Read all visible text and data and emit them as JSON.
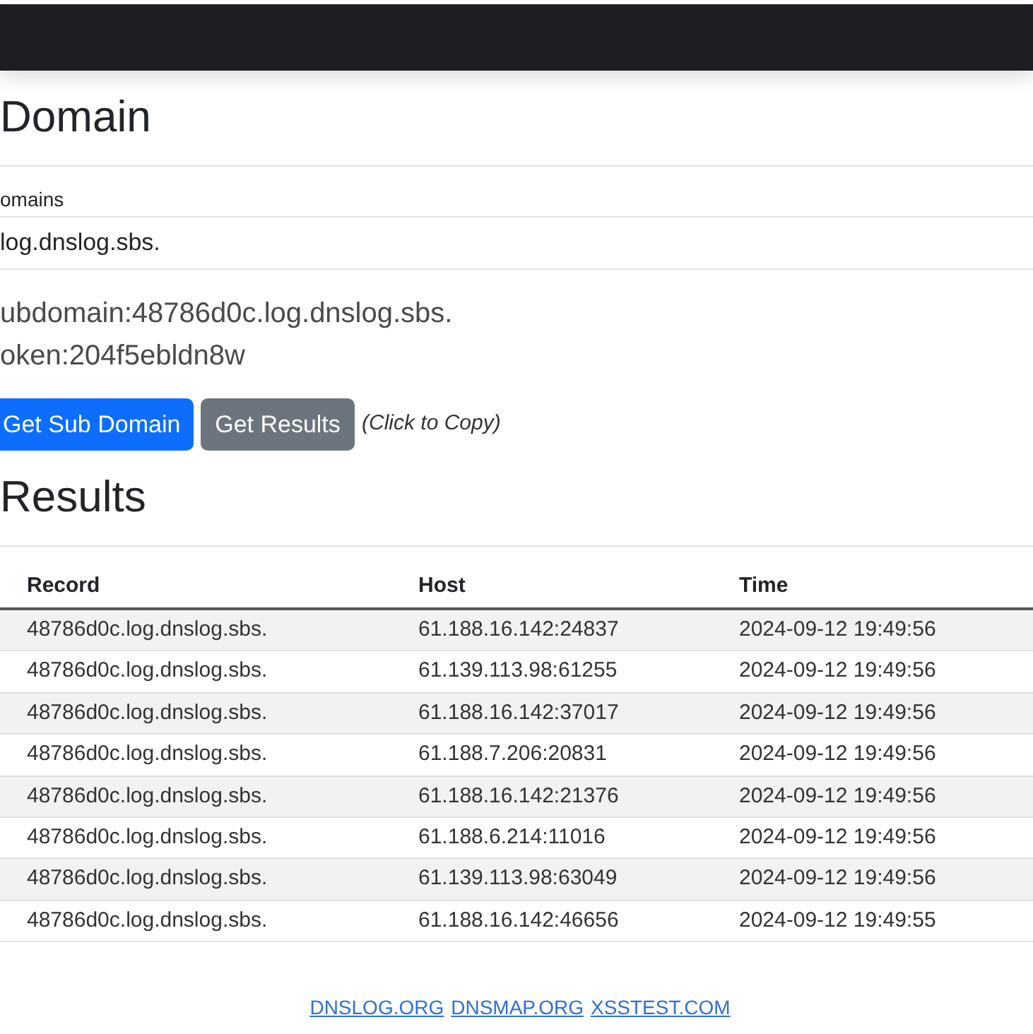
{
  "domain_section": {
    "heading": "Domain",
    "table": {
      "column": "omains",
      "value": "log.dnslog.sbs."
    },
    "subdomain": "ubdomain:48786d0c.log.dnslog.sbs.",
    "token": "oken:204f5ebldn8w",
    "buttons": [
      {
        "label": "Get Sub Domain",
        "kind": "primary"
      },
      {
        "label": "Get Results",
        "kind": "secondary"
      }
    ],
    "copy_hint": "(Click to Copy)"
  },
  "results_section": {
    "heading": "Results",
    "table": {
      "columns": [
        "Record",
        "Host",
        "Time"
      ],
      "rows": [
        {
          "record": "48786d0c.log.dnslog.sbs.",
          "host": "61.188.16.142:24837",
          "time": "2024-09-12 19:49:56"
        },
        {
          "record": "48786d0c.log.dnslog.sbs.",
          "host": "61.139.113.98:61255",
          "time": "2024-09-12 19:49:56"
        },
        {
          "record": "48786d0c.log.dnslog.sbs.",
          "host": "61.188.16.142:37017",
          "time": "2024-09-12 19:49:56"
        },
        {
          "record": "48786d0c.log.dnslog.sbs.",
          "host": "61.188.7.206:20831",
          "time": "2024-09-12 19:49:56"
        },
        {
          "record": "48786d0c.log.dnslog.sbs.",
          "host": "61.188.16.142:21376",
          "time": "2024-09-12 19:49:56"
        },
        {
          "record": "48786d0c.log.dnslog.sbs.",
          "host": "61.188.6.214:11016",
          "time": "2024-09-12 19:49:56"
        },
        {
          "record": "48786d0c.log.dnslog.sbs.",
          "host": "61.139.113.98:63049",
          "time": "2024-09-12 19:49:56"
        },
        {
          "record": "48786d0c.log.dnslog.sbs.",
          "host": "61.188.16.142:46656",
          "time": "2024-09-12 19:49:55"
        }
      ]
    }
  },
  "footer": {
    "links": [
      "DNSLOG.ORG",
      "DNSMAP.ORG",
      "XSSTEST.COM"
    ]
  }
}
